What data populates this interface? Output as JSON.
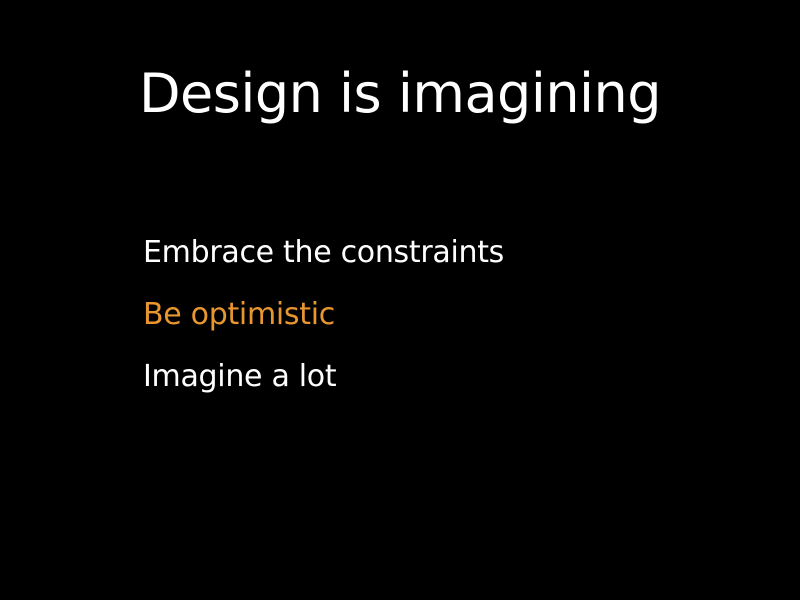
{
  "slide": {
    "title": "Design is imagining",
    "bullets": [
      {
        "text": "Embrace the constraints",
        "highlighted": false
      },
      {
        "text": "Be optimistic",
        "highlighted": true
      },
      {
        "text": "Imagine a lot",
        "highlighted": false
      }
    ]
  },
  "colors": {
    "background": "#000000",
    "text": "#ffffff",
    "accent": "#e8962f"
  }
}
